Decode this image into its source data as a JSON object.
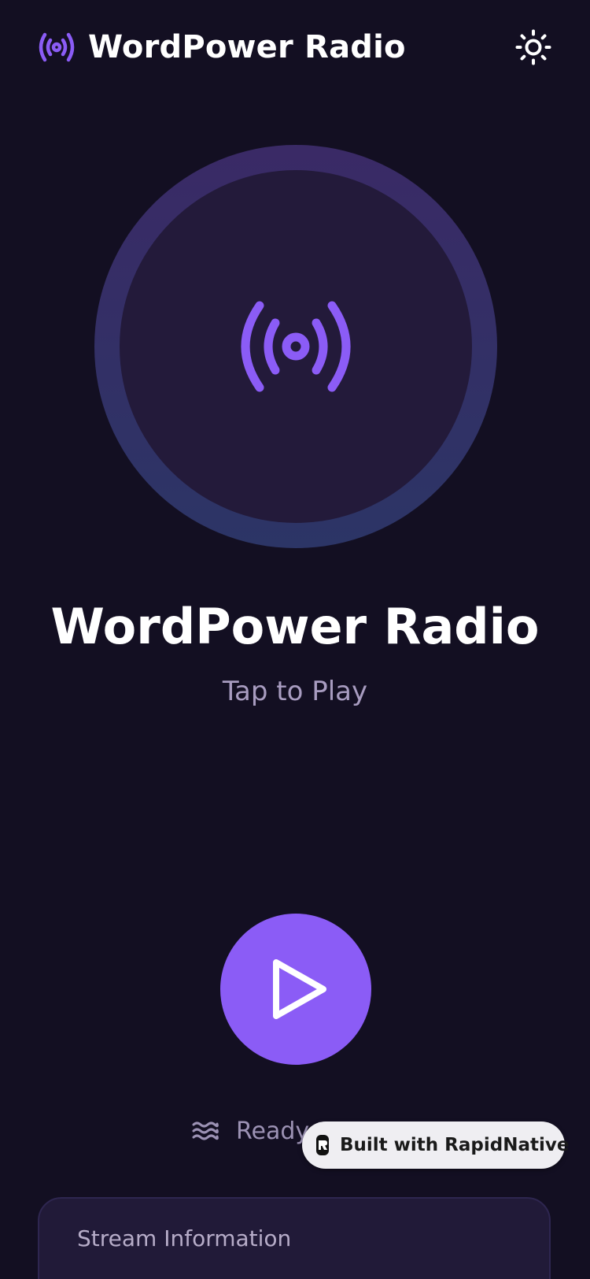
{
  "header": {
    "title": "WordPower Radio",
    "brand_icon": "radio-broadcast-icon",
    "theme_icon": "sun-icon"
  },
  "hero": {
    "icon": "radio-broadcast-icon",
    "station_name": "WordPower Radio",
    "subtitle": "Tap to Play"
  },
  "player": {
    "play_icon": "play-icon"
  },
  "status": {
    "icon": "waves-icon",
    "text": "Ready t"
  },
  "badge": {
    "label": "Built with RapidNative",
    "logo": "rapidnative-logo"
  },
  "stream_info": {
    "title": "Stream Information"
  },
  "colors": {
    "background": "#130f22",
    "accent": "#8b5cf6",
    "hero_inner": "#231a3a",
    "muted_text": "#a89cc0"
  }
}
